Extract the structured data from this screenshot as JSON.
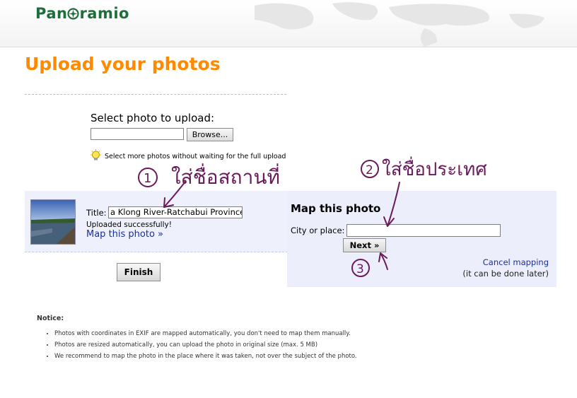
{
  "header": {
    "logo_text_left": "Pan",
    "logo_text_right": "ramio",
    "brand_color": "#1e6e3c"
  },
  "page": {
    "title": "Upload your photos",
    "title_color": "#ff8a00"
  },
  "upload": {
    "select_label": "Select photo to upload:",
    "file_value": "",
    "browse_label": "Browse...",
    "tip_text": "Select more photos without waiting for the full upload",
    "tip_icon": "lightbulb-icon"
  },
  "photo": {
    "title_label": "Title:",
    "title_value": "a Klong River-Ratchabui Province",
    "status": "Uploaded successfully!",
    "map_link": "Map this photo »"
  },
  "map": {
    "heading": "Map this photo",
    "city_label": "City or place:",
    "city_value": "",
    "next_label": "Next »",
    "cancel_link": "Cancel mapping",
    "cancel_note": "(it can be done later)"
  },
  "finish_label": "Finish",
  "notice": {
    "title": "Notice:",
    "items": [
      "Photos with coordinates in EXIF are mapped automatically, you don't need to map them manually.",
      "Photos are resized automatically, you can upload the photo in original size (max. 5 MB)",
      "We recommend to map the photo in the place where it was taken, not over the subject of the photo."
    ]
  },
  "annotations": {
    "color": "#6b1a5c",
    "marker_1": "1",
    "marker_2": "2",
    "marker_3": "3",
    "note_1": "ใส่ชื่อสถานที่",
    "note_2": "ใส่ชื่อประเทศ"
  }
}
